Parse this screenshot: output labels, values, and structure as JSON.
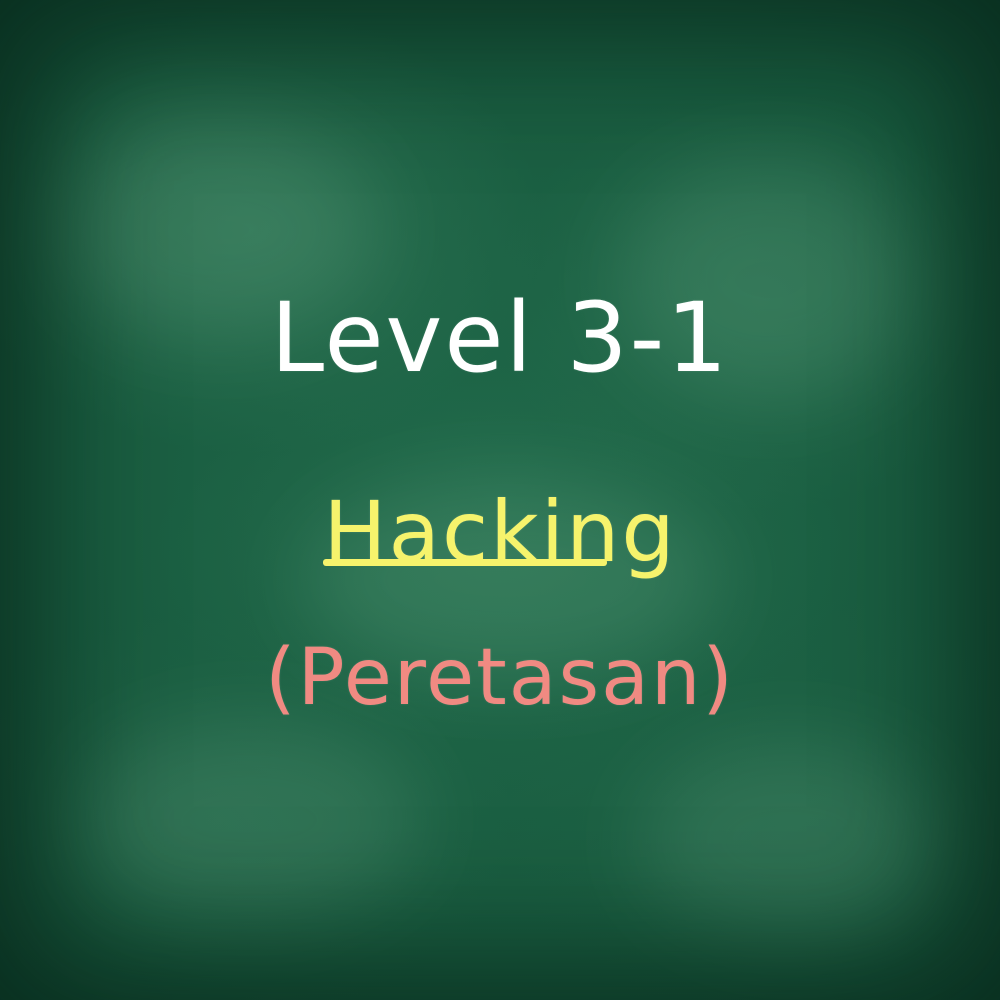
{
  "board": {
    "title": "Level 3-1",
    "topic": "Hacking",
    "translation": "(Peretasan)"
  },
  "colors": {
    "board_green": "#1b5a3f",
    "title_white": "#ffffff",
    "topic_yellow": "#f6f36c",
    "translation_pink": "#f08a82"
  }
}
